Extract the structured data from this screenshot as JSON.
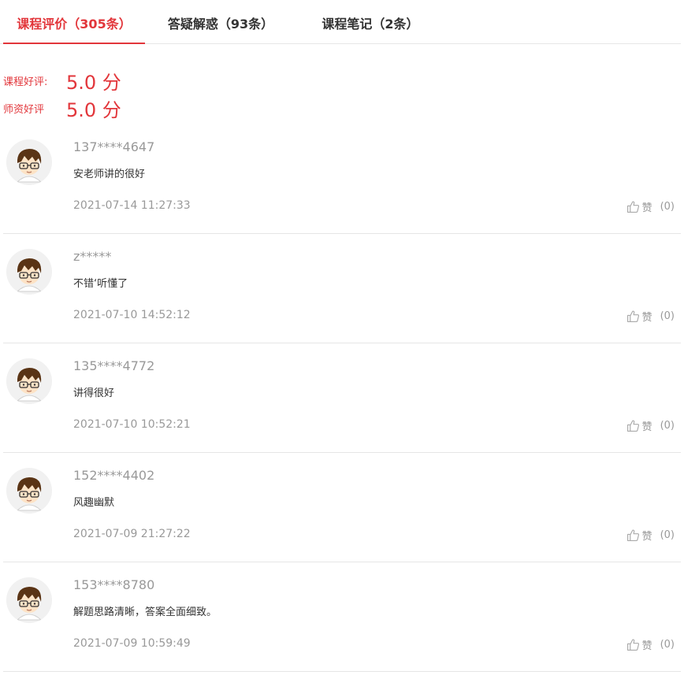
{
  "tabs": [
    {
      "label": "课程评价（305条）",
      "active": true
    },
    {
      "label": "答疑解惑（93条）",
      "active": false
    },
    {
      "label": "课程笔记（2条）",
      "active": false
    }
  ],
  "ratings": {
    "course": {
      "label": "课程好评:",
      "value": "5.0 分"
    },
    "teacher": {
      "label": "师资好评",
      "value": "5.0 分"
    }
  },
  "reviews": [
    {
      "user": "137****4647",
      "comment": "安老师讲的很好",
      "time": "2021-07-14 11:27:33",
      "like_label": "赞",
      "like_count": "(0)"
    },
    {
      "user": "z*****",
      "comment": "不错‘听懂了",
      "time": "2021-07-10 14:52:12",
      "like_label": "赞",
      "like_count": "(0)"
    },
    {
      "user": "135****4772",
      "comment": "讲得很好",
      "time": "2021-07-10 10:52:21",
      "like_label": "赞",
      "like_count": "(0)"
    },
    {
      "user": "152****4402",
      "comment": "风趣幽默",
      "time": "2021-07-09 21:27:22",
      "like_label": "赞",
      "like_count": "(0)"
    },
    {
      "user": "153****8780",
      "comment": "解题思路清晰，答案全面细致。",
      "time": "2021-07-09 10:59:49",
      "like_label": "赞",
      "like_count": "(0)"
    }
  ],
  "colors": {
    "accent": "#e2363b",
    "muted": "#999999",
    "divider": "#e6e6e6"
  },
  "icons": {
    "like": "thumbs-up-icon",
    "avatar": "cartoon-boy-avatar"
  }
}
